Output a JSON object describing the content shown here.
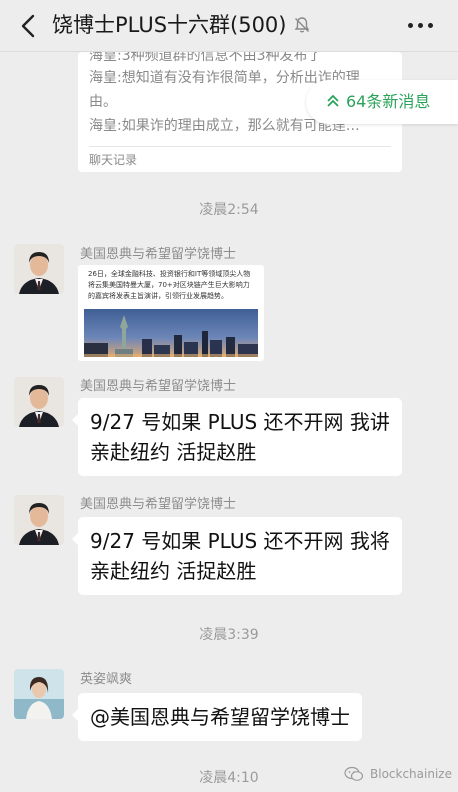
{
  "header": {
    "title": "饶博士PLUS十六群(500)",
    "back_icon": "chevron-left-icon",
    "mute_icon": "bell-off-icon",
    "more_icon": "more-dots-icon"
  },
  "quote_card": {
    "lines": [
      "海皇:3种频道群的信息不由3种发布了",
      "海皇:想知道有没有诈很简单，分析出诈的理",
      "由。",
      "海皇:如果诈的理由成立，那么就有可能逹…"
    ],
    "footer": "聊天记录"
  },
  "new_messages": {
    "label": "64条新消息",
    "icon": "double-chevron-up-icon",
    "accent": "#2aa35a"
  },
  "messages": [
    {
      "time": "凌晨2:54"
    },
    {
      "sender": "美国恩典与希望留学饶博士",
      "type": "image",
      "image_caption": "26日，全球金融科技、投资银行和IT等领域顶尖人物将云集美国特曼大厦，70+对区块链产生巨大影响力的嘉宾将发表主旨演讲，引领行业发展趋势。"
    },
    {
      "sender": "美国恩典与希望留学饶博士",
      "type": "text",
      "lines": [
        "9/27 号如果 PLUS 还不开网 我讲",
        "亲赴纽约 活捉赵胜"
      ]
    },
    {
      "sender": "美国恩典与希望留学饶博士",
      "type": "text",
      "lines": [
        "9/27 号如果 PLUS 还不开网 我将",
        "亲赴纽约 活捉赵胜"
      ]
    },
    {
      "time": "凌晨3:39"
    },
    {
      "sender": "英姿飒爽",
      "type": "text",
      "lines": [
        "@美国恩典与希望留学饶博士"
      ]
    },
    {
      "time": "凌晨4:10"
    }
  ],
  "watermark": {
    "text": "Blockchainize",
    "icon": "wechat-icon"
  }
}
